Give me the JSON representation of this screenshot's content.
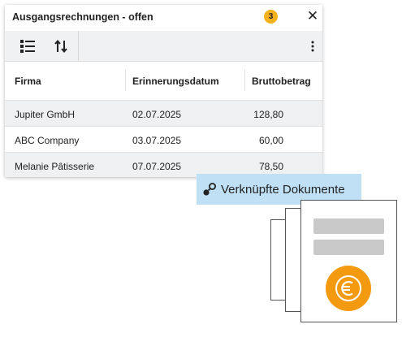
{
  "panel": {
    "title": "Ausgangsrechnungen - offen",
    "badge_count": "3",
    "close_glyph": "✕"
  },
  "toolbar": {
    "list_icon": "list-icon",
    "sort_icon": "sort-icon",
    "more_icon": "more-vertical-icon"
  },
  "table": {
    "columns": [
      "Firma",
      "Erinnerungsdatum",
      "Bruttobetrag"
    ],
    "rows": [
      {
        "firma": "Jupiter GmbH",
        "datum": "02.07.2025",
        "betrag": "128,80"
      },
      {
        "firma": "ABC Company",
        "datum": "03.07.2025",
        "betrag": "60,00"
      },
      {
        "firma": "Melanie Pâtisserie",
        "datum": "07.07.2025",
        "betrag": "78,50"
      }
    ]
  },
  "linked": {
    "label": "Verknüpfte Dokumente",
    "icon": "link-icon"
  },
  "colors": {
    "badge": "#f3b21b",
    "link_tag_bg": "#bfe0f5",
    "euro": "#f39a10"
  }
}
